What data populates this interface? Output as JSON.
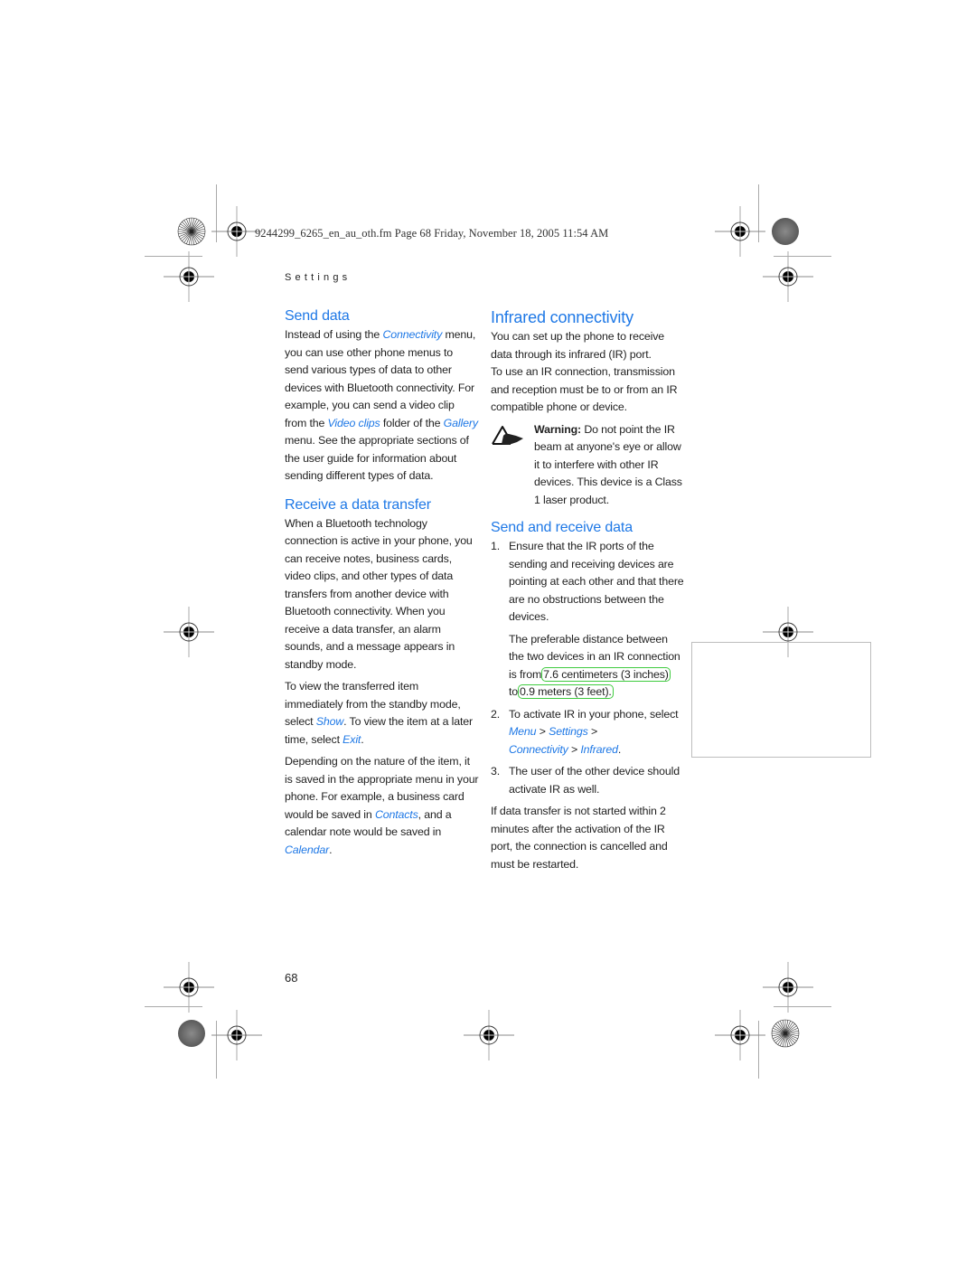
{
  "slug_line": "9244299_6265_en_au_oth.fm  Page 68  Friday, November 18, 2005  11:54 AM",
  "running_head": "Settings",
  "page_number": "68",
  "colors": {
    "heading": "#1e78e6",
    "link": "#1e78e6",
    "highlight_box": "#3ecb3e",
    "text": "#1f1f1f"
  },
  "left_column": {
    "send_data": {
      "title": "Send data",
      "p1_a": "Instead of using the ",
      "p1_link1": "Connectivity",
      "p1_b": " menu, you can use other phone menus to send various types of data to other devices with Bluetooth connectivity. For example, you can send a video clip from the ",
      "p1_link2": "Video clips",
      "p1_c": " folder of the ",
      "p1_link3": "Gallery",
      "p1_d": " menu. See the appropriate sections of the user guide for information about sending different types of data."
    },
    "receive": {
      "title": "Receive a data transfer",
      "p1": "When a Bluetooth technology connection is active in your phone, you can receive notes, business cards, video clips, and other types of data transfers from another device with Bluetooth connectivity. When you receive a data transfer, an alarm sounds, and a message appears in standby mode.",
      "p2_a": "To view the transferred item immediately from the standby mode, select ",
      "p2_link1": "Show",
      "p2_b": ". To view the item at a later time, select ",
      "p2_link2": "Exit",
      "p2_c": ".",
      "p3_a": "Depending on the nature of the item, it is saved in the appropriate menu in your phone. For example, a business card would be saved in ",
      "p3_link1": "Contacts",
      "p3_b": ", and a calendar note would be saved in ",
      "p3_link2": "Calendar",
      "p3_c": "."
    }
  },
  "right_column": {
    "infrared": {
      "title": "Infrared connectivity",
      "p1": "You can set up the phone to receive data through its infrared (IR) port.",
      "p2": "To use an IR connection, transmission and reception must be to or from an IR compatible phone or device.",
      "warning_icon": "warning-hand-icon",
      "warning_label": "Warning:",
      "warning_text": " Do not point the IR beam at anyone's eye or allow it to interfere with other IR devices. This device is a Class 1 laser product."
    },
    "send_receive": {
      "title": "Send and receive data",
      "steps": [
        {
          "num": "1.",
          "text": "Ensure that the IR ports of the sending and receiving devices are pointing at each other and that there are no obstructions between the devices."
        },
        {
          "num": "2.",
          "text_a": "To activate IR in your phone, select ",
          "link1": "Menu",
          "sep1": " > ",
          "link2": "Settings",
          "sep2": " > ",
          "link3": "Connectivity",
          "sep3": " > ",
          "link4": "Infrared",
          "end": "."
        },
        {
          "num": "3.",
          "text": "The user of the other device should activate IR as well."
        }
      ],
      "distance_a": "The preferable distance between the two devices in an IR connection is from",
      "distance_min": "7.6 centimeters (3 inches)",
      "distance_b": "to",
      "distance_max": "0.9 meters (3 feet).",
      "footer": "If data transfer is not started within 2 minutes after the activation of the IR port, the connection is cancelled and must be restarted."
    }
  }
}
